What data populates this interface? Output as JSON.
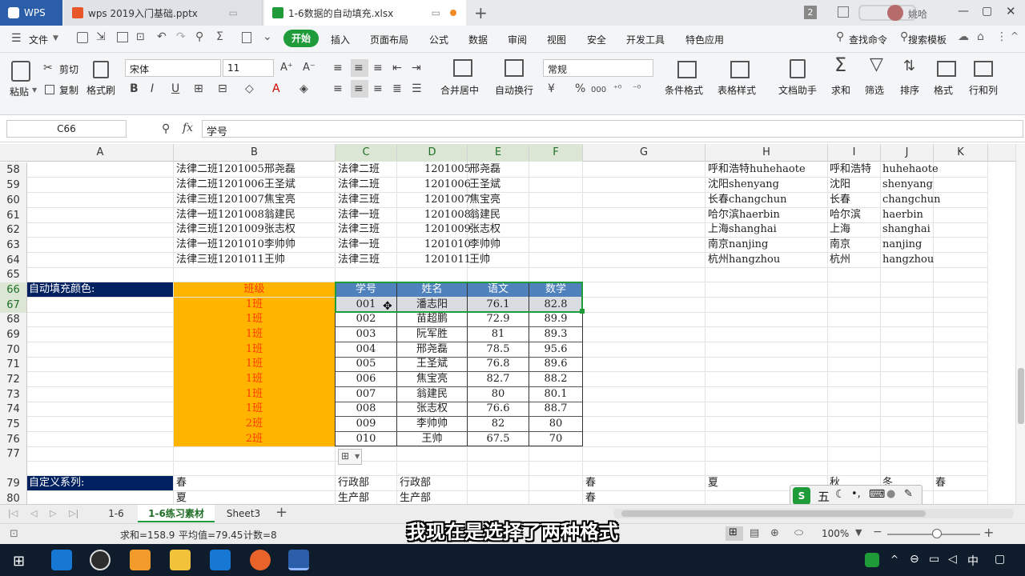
{
  "titlebar": {
    "tabs": [
      {
        "label": "WPS",
        "icon": "wps-icon"
      },
      {
        "label": "wps 2019入门基础.pptx",
        "icon": "pptx-file-icon"
      },
      {
        "label": "1-6数据的自动填充.xlsx",
        "icon": "xlsx-file-icon"
      }
    ],
    "window_badge": "2",
    "user_name": "姚哈"
  },
  "menubar": {
    "file_label": "文件",
    "items": [
      "开始",
      "插入",
      "页面布局",
      "公式",
      "数据",
      "审阅",
      "视图",
      "安全",
      "开发工具",
      "特色应用"
    ],
    "active_item": "开始",
    "search_label": "查找命令",
    "template_label": "搜索模板"
  },
  "ribbon": {
    "paste": "粘贴",
    "cut": "剪切",
    "copy": "复制",
    "format_painter": "格式刷",
    "font_name": "宋体",
    "font_size": "11",
    "merge_center": "合并居中",
    "wrap_text": "自动换行",
    "number_format": "常规",
    "conditional_format": "条件格式",
    "table_style": "表格样式",
    "doc_helper": "文档助手",
    "sum": "求和",
    "filter": "筛选",
    "sort": "排序",
    "format": "格式",
    "rows_cols": "行和列",
    "bold": "B",
    "italic": "I",
    "underline": "U",
    "percent": "%",
    "thousands": "000"
  },
  "formula_bar": {
    "name_box": "C66",
    "fx": "fx",
    "content": "学号"
  },
  "columns": [
    "A",
    "B",
    "C",
    "D",
    "E",
    "F",
    "G",
    "H",
    "I",
    "J",
    "K"
  ],
  "row_numbers": [
    "58",
    "59",
    "60",
    "61",
    "62",
    "63",
    "64",
    "65",
    "66",
    "67",
    "68",
    "69",
    "70",
    "71",
    "72",
    "73",
    "74",
    "75",
    "76",
    "77",
    "79",
    "80"
  ],
  "sheet": {
    "upper_rows": [
      {
        "b": "法律二班1201005邢尧磊",
        "c": "法律二班",
        "d": "1201005",
        "e": "邢尧磊",
        "h": "呼和浩特huhehaote",
        "i": "呼和浩特",
        "j": "huhehaote"
      },
      {
        "b": "法律二班1201006王圣斌",
        "c": "法律二班",
        "d": "1201006",
        "e": "王圣斌",
        "h": "沈阳shenyang",
        "i": "沈阳",
        "j": "shenyang"
      },
      {
        "b": "法律三班1201007焦宝亮",
        "c": "法律三班",
        "d": "1201007",
        "e": "焦宝亮",
        "h": "长春changchun",
        "i": "长春",
        "j": "changchun"
      },
      {
        "b": "法律一班1201008翁建民",
        "c": "法律一班",
        "d": "1201008",
        "e": "翁建民",
        "h": "哈尔滨haerbin",
        "i": "哈尔滨",
        "j": "haerbin"
      },
      {
        "b": "法律三班1201009张志权",
        "c": "法律三班",
        "d": "1201009",
        "e": "张志权",
        "h": "上海shanghai",
        "i": "上海",
        "j": "shanghai"
      },
      {
        "b": "法律一班1201010李帅帅",
        "c": "法律一班",
        "d": "1201010",
        "e": "李帅帅",
        "h": "南京nanjing",
        "i": "南京",
        "j": "nanjing"
      },
      {
        "b": "法律三班1201011王帅",
        "c": "法律三班",
        "d": "1201011",
        "e": "王帅",
        "h": "杭州hangzhou",
        "i": "杭州",
        "j": "hangzhou"
      }
    ],
    "autofill_label": "自动填充颜色:",
    "table_header": {
      "class": "班级",
      "id": "学号",
      "name": "姓名",
      "chinese": "语文",
      "math": "数学"
    },
    "table_rows": [
      {
        "class": "1班",
        "id": "001",
        "name": "潘志阳",
        "chinese": "76.1",
        "math": "82.8"
      },
      {
        "class": "1班",
        "id": "002",
        "name": "苗超鹏",
        "chinese": "72.9",
        "math": "89.9"
      },
      {
        "class": "1班",
        "id": "003",
        "name": "阮军胜",
        "chinese": "81",
        "math": "89.3"
      },
      {
        "class": "1班",
        "id": "004",
        "name": "邢尧磊",
        "chinese": "78.5",
        "math": "95.6"
      },
      {
        "class": "1班",
        "id": "005",
        "name": "王圣斌",
        "chinese": "76.8",
        "math": "89.6"
      },
      {
        "class": "1班",
        "id": "006",
        "name": "焦宝亮",
        "chinese": "82.7",
        "math": "88.2"
      },
      {
        "class": "1班",
        "id": "007",
        "name": "翁建民",
        "chinese": "80",
        "math": "80.1"
      },
      {
        "class": "1班",
        "id": "008",
        "name": "张志权",
        "chinese": "76.6",
        "math": "88.7"
      },
      {
        "class": "2班",
        "id": "009",
        "name": "李帅帅",
        "chinese": "82",
        "math": "80"
      },
      {
        "class": "2班",
        "id": "010",
        "name": "王帅",
        "chinese": "67.5",
        "math": "70"
      }
    ],
    "custom_series_label": "自定义系列:",
    "row79": {
      "b": "春",
      "c": "行政部",
      "d": "行政部",
      "g": "春",
      "h": "夏",
      "i": "秋",
      "j": "冬",
      "k": "春"
    },
    "row80": {
      "b": "夏",
      "c": "生产部",
      "d": "生产部",
      "g": "春"
    }
  },
  "sheet_tabs": [
    "1-6",
    "1-6练习素材",
    "Sheet3"
  ],
  "active_sheet": "1-6练习素材",
  "status": {
    "sum": "求和=158.9",
    "avg": "平均值=79.45",
    "count": "计数=8",
    "zoom": "100%"
  },
  "ime": {
    "label": "五"
  },
  "subtitle": "我现在是选择了两种格式",
  "colors": {
    "accent": "#1f9b3a",
    "header_blue": "#4f81bd",
    "orange_fill": "#ffb500",
    "label_navy": "#002060",
    "class_text": "#ff3c00"
  }
}
